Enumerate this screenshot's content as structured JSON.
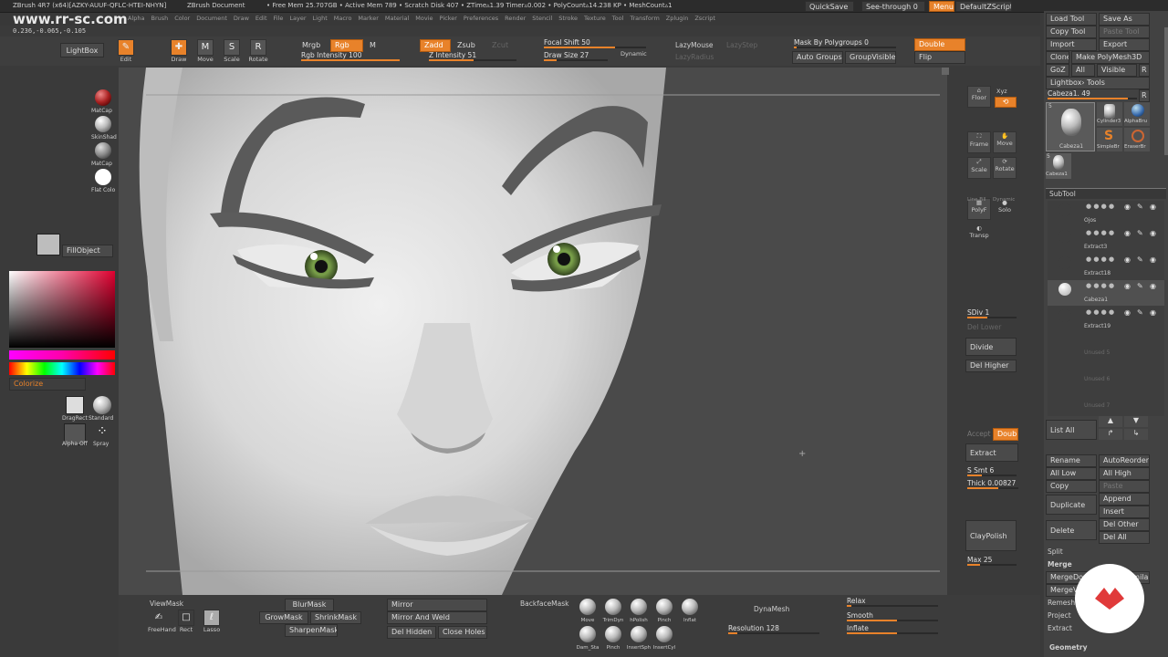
{
  "titlebar": {
    "app_title": "ZBrush 4R7 (x64)[AZKY-AUUF-QFLC-HTEI-NHYN]",
    "document": "ZBrush Document",
    "stats": "• Free Mem 25.707GB • Active Mem 789 • Scratch Disk 407 • ZTime▵1.39 Timer▵0.002 • PolyCount▵14.238 KP • MeshCount▵1",
    "quicksave": "QuickSave",
    "seethrough": "See-through  0",
    "menus": "Menus",
    "defaultscript": "DefaultZScript"
  },
  "coords": "0.236,-0.065,-0.105",
  "watermark": "www.rr-sc.com",
  "menu": [
    "Alpha",
    "Brush",
    "Color",
    "Document",
    "Draw",
    "Edit",
    "File",
    "Layer",
    "Light",
    "Macro",
    "Marker",
    "Material",
    "Movie",
    "Picker",
    "Preferences",
    "Render",
    "Stencil",
    "Stroke",
    "Texture",
    "Tool",
    "Transform",
    "Zplugin",
    "Zscript"
  ],
  "top_toolbar": {
    "lightbox": "LightBox",
    "edit": "Edit",
    "draw": "Draw",
    "move": "Move",
    "scale": "Scale",
    "rotate": "Rotate",
    "mrgb": "Mrgb",
    "rgb": "Rgb",
    "m": "M",
    "rgb_intensity": "Rgb  Intensity  100",
    "zadd": "Zadd",
    "zsub": "Zsub",
    "zcut": "Zcut",
    "z_intensity": "Z  Intensity  51",
    "focal_shift": "Focal  Shift  50",
    "draw_size": "Draw  Size  27",
    "dynamic": "Dynamic",
    "lazymouse": "LazyMouse",
    "lazystep": "LazyStep",
    "lazyradius": "LazyRadius",
    "mask_by_polygroups": "Mask  By  Polygroups  0",
    "auto_groups": "Auto  Groups",
    "groupvisible": "GroupVisible",
    "double": "Double",
    "flip": "Flip"
  },
  "left_shelf": {
    "materials": [
      "MatCap",
      "SkinShad",
      "MatCap",
      "Flat Colo"
    ],
    "fillobject": "FillObject",
    "colorize": "Colorize",
    "dragrect": "DragRect",
    "standard": "Standard",
    "alpha_off": "Alpha  Off",
    "spray": "Spray"
  },
  "right_shelf": {
    "floor": "Floor",
    "xyz": "Xyz",
    "local": "Local",
    "frame": "Frame",
    "move": "Move",
    "scale": "Scale",
    "rotate": "Rotate",
    "polyf": "PolyF",
    "solo": "Solo",
    "linefill": "Line Fill",
    "dynamic": "Dynamic",
    "transp": "Transp",
    "sdiv": "SDiv 1",
    "del_lower": "Del Lower",
    "divide": "Divide",
    "del_higher": "Del Higher",
    "accept": "Accept",
    "double": "Double",
    "extract": "Extract",
    "s_smt": "S Smt 6",
    "thick": "Thick 0.00827",
    "claypolish": "ClayPolish",
    "max": "Max 25"
  },
  "tool_panel": {
    "load_tool": "Load Tool",
    "save_as": "Save As",
    "copy_tool": "Copy Tool",
    "paste_tool": "Paste Tool",
    "import": "Import",
    "export": "Export",
    "clone": "Clone",
    "make_polymesh": "Make PolyMesh3D",
    "goz": "GoZ",
    "all": "All",
    "visible": "Visible",
    "r": "R",
    "lightbox_tools": "Lightbox› Tools",
    "cabeza": "Cabeza1. 49",
    "r2": "R",
    "thumb_count": "5",
    "thumb_count2": "5",
    "thumbs": [
      "Cabeza1",
      "Cylinder3",
      "AlphaBru",
      "SimpleBr",
      "EraserBr",
      "Cabeza1"
    ],
    "subtool": "SubTool",
    "subtools": [
      "Ojos",
      "Extract3",
      "Extract18",
      "Cabeza1",
      "Extract19",
      "Unused 5",
      "Unused 6",
      "Unused 7"
    ],
    "list_all": "List  All",
    "rename": "Rename",
    "autoreorder": "AutoReorder",
    "all_low": "All Low",
    "all_high": "All High",
    "copy": "Copy",
    "paste": "Paste",
    "duplicate": "Duplicate",
    "append": "Append",
    "insert": "Insert",
    "delete": "Delete",
    "del_other": "Del Other",
    "del_all": "Del All",
    "split": "Split",
    "merge": "Merge",
    "merge_down": "MergeDown",
    "merge_similar": "MergeSimilar",
    "merge_visible": "MergeVisible",
    "remesh": "Remesh",
    "project": "Project",
    "extract": "Extract",
    "geometry": "Geometry"
  },
  "bottom_shelf": {
    "viewmask": "ViewMask",
    "freehand": "FreeHand",
    "rect": "Rect",
    "lasso": "Lasso",
    "blurmask": "BlurMask",
    "growmask": "GrowMask",
    "shrinkmask": "ShrinkMask",
    "sharpenmask": "SharpenMask",
    "mirror": "Mirror",
    "mirror_and_weld": "Mirror And Weld",
    "del_hidden": "Del Hidden",
    "close_holes": "Close Holes",
    "backfacemask": "BackfaceMask",
    "brushes": [
      "Move",
      "TrimDyn",
      "hPolish",
      "Pinch",
      "Inflat",
      "Dam_Sta",
      "Pinch",
      "InsertSph",
      "InsertCyl"
    ],
    "dynamesh": "DynaMesh",
    "resolution": "Resolution  128",
    "relax": "Relax",
    "smooth": "Smooth",
    "inflate": "Inflate"
  },
  "colors": {
    "accent": "#e8822a",
    "bg": "#3a3a3a",
    "panel": "#444444"
  }
}
